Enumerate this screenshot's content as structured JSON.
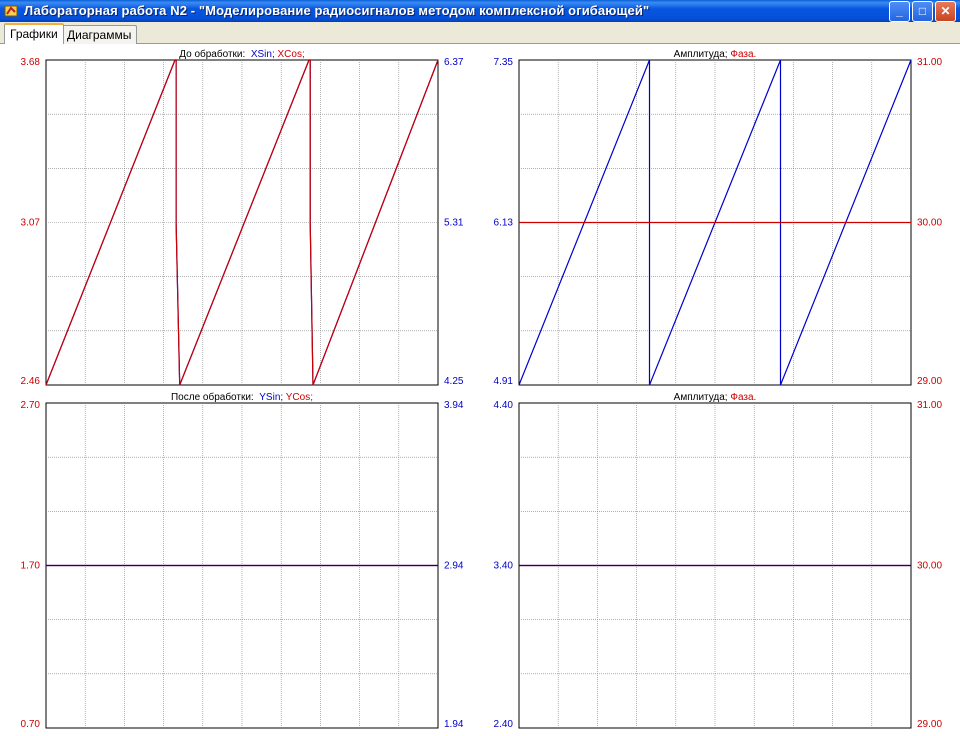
{
  "window": {
    "title": "Лабораторная работа N2 - \"Моделирование радиосигналов методом комплексной огибающей\"",
    "icons": [
      "app-icon",
      "minimize-icon",
      "maximize-icon",
      "close-icon"
    ]
  },
  "tabs": [
    {
      "label": "Графики",
      "active": true
    },
    {
      "label": "Диаграммы",
      "active": false
    }
  ],
  "colors": {
    "blue": "#0000cc",
    "red": "#cc0000",
    "grid": "#808080"
  },
  "chart_data": [
    {
      "type": "line",
      "title_parts": [
        {
          "text": "До обработки:  ",
          "color": "#000000"
        },
        {
          "text": "XSin; ",
          "color": "#0000cc"
        },
        {
          "text": "XCos;",
          "color": "#cc0000"
        }
      ],
      "y_left": {
        "ticks": [
          "3.68",
          "3.07",
          "2.46"
        ],
        "ylim": [
          2.46,
          3.68
        ],
        "color": "#cc0000"
      },
      "y_right": {
        "ticks": [
          "6.37",
          "5.31",
          "4.25"
        ],
        "ylim": [
          4.25,
          6.37
        ],
        "color": "#0000cc"
      },
      "xlim": [
        0,
        1
      ],
      "grid": true,
      "series": [
        {
          "color": "#0000cc",
          "axis": "right",
          "x": [
            0,
            0.329,
            0.332,
            0.332,
            0.341,
            0.671,
            0.674,
            0.674,
            0.681,
            1.0
          ],
          "y": [
            4.25,
            6.37,
            6.37,
            5.31,
            4.25,
            6.37,
            6.37,
            5.31,
            4.25,
            6.37
          ]
        },
        {
          "color": "#cc0000",
          "axis": "left",
          "x": [
            0,
            0.329,
            0.332,
            0.332,
            0.341,
            0.671,
            0.674,
            0.674,
            0.681,
            1.0
          ],
          "y": [
            2.46,
            3.68,
            3.68,
            3.07,
            2.46,
            3.68,
            3.68,
            3.07,
            2.46,
            3.68
          ]
        }
      ]
    },
    {
      "type": "line",
      "title_parts": [
        {
          "text": "Амплитуда; ",
          "color": "#000000"
        },
        {
          "text": "Фаза.",
          "color": "#cc0000"
        }
      ],
      "y_left": {
        "ticks": [
          "7.35",
          "6.13",
          "4.91"
        ],
        "ylim": [
          4.91,
          7.35
        ],
        "color": "#0000cc"
      },
      "y_right": {
        "ticks": [
          "31.00",
          "30.00",
          "29.00"
        ],
        "ylim": [
          29.0,
          31.0
        ],
        "color": "#cc0000"
      },
      "xlim": [
        0,
        1
      ],
      "grid": true,
      "series": [
        {
          "color": "#0000cc",
          "axis": "left",
          "x": [
            0,
            0.333,
            0.333,
            0.667,
            0.667,
            1.0
          ],
          "y": [
            4.91,
            7.35,
            4.91,
            7.35,
            4.91,
            7.35
          ]
        },
        {
          "color": "#cc0000",
          "axis": "right",
          "x": [
            0,
            1.0
          ],
          "y": [
            30.0,
            30.0
          ]
        }
      ]
    },
    {
      "type": "line",
      "title_parts": [
        {
          "text": "После обработки:  ",
          "color": "#000000"
        },
        {
          "text": "YSin; ",
          "color": "#0000cc"
        },
        {
          "text": "YCos;",
          "color": "#cc0000"
        }
      ],
      "y_left": {
        "ticks": [
          "2.70",
          "1.70",
          "0.70"
        ],
        "ylim": [
          0.7,
          2.7
        ],
        "color": "#cc0000"
      },
      "y_right": {
        "ticks": [
          "3.94",
          "2.94",
          "1.94"
        ],
        "ylim": [
          1.94,
          3.94
        ],
        "color": "#0000cc"
      },
      "xlim": [
        0,
        1
      ],
      "grid": true,
      "series": [
        {
          "color": "#cc0000",
          "axis": "left",
          "x": [
            0,
            1.0
          ],
          "y": [
            1.7,
            1.7
          ]
        },
        {
          "color": "#0000cc",
          "axis": "right",
          "x": [
            0,
            1.0
          ],
          "y": [
            2.94,
            2.94
          ]
        }
      ]
    },
    {
      "type": "line",
      "title_parts": [
        {
          "text": "Амплитуда; ",
          "color": "#000000"
        },
        {
          "text": "Фаза.",
          "color": "#cc0000"
        }
      ],
      "y_left": {
        "ticks": [
          "4.40",
          "3.40",
          "2.40"
        ],
        "ylim": [
          2.4,
          4.4
        ],
        "color": "#0000cc"
      },
      "y_right": {
        "ticks": [
          "31.00",
          "30.00",
          "29.00"
        ],
        "ylim": [
          29.0,
          31.0
        ],
        "color": "#cc0000"
      },
      "xlim": [
        0,
        1
      ],
      "grid": true,
      "series": [
        {
          "color": "#cc0000",
          "axis": "right",
          "x": [
            0,
            1.0
          ],
          "y": [
            30.0,
            30.0
          ]
        },
        {
          "color": "#0000cc",
          "axis": "left",
          "x": [
            0,
            1.0
          ],
          "y": [
            3.4,
            3.4
          ]
        }
      ]
    }
  ]
}
